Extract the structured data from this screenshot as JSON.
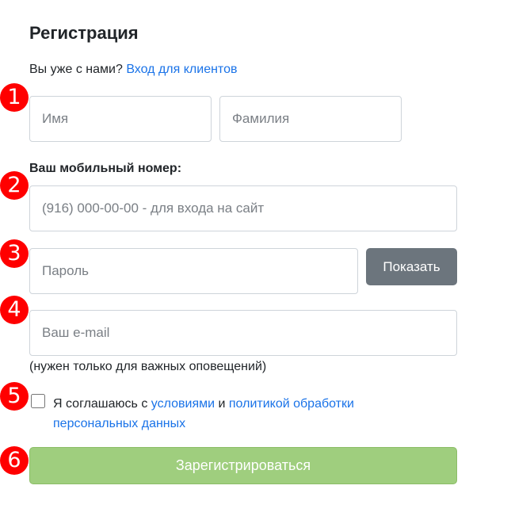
{
  "form": {
    "title": "Регистрация",
    "already_text": "Вы уже с нами?",
    "login_link": "Вход для клиентов",
    "first_name_placeholder": "Имя",
    "last_name_placeholder": "Фамилия",
    "phone_label": "Ваш мобильный номер:",
    "phone_placeholder": "(916) 000-00-00 - для входа на сайт",
    "password_placeholder": "Пароль",
    "show_button": "Показать",
    "email_placeholder": "Ваш e-mail",
    "email_hint": "(нужен только для важных оповещений)",
    "agree_prefix": "Я соглашаюсь с",
    "agree_terms_link": "условиями",
    "agree_and": "и",
    "agree_policy_link": "политикой обработки персональных данных",
    "submit_button": "Зарегистрироваться"
  },
  "markers": [
    "1",
    "2",
    "3",
    "4",
    "5",
    "6"
  ],
  "colors": {
    "link": "#1a73e8",
    "show_button_bg": "#6c757d",
    "submit_bg": "#9fce7e",
    "marker_bg": "#ff0000"
  }
}
